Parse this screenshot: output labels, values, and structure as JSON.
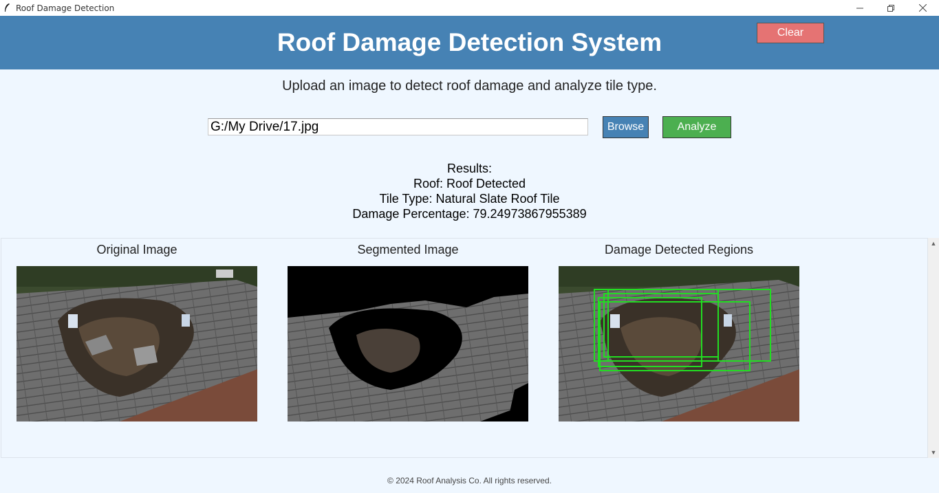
{
  "window": {
    "title": "Roof Damage Detection",
    "icon": "feather-icon"
  },
  "header": {
    "title": "Roof Damage Detection System",
    "clear_label": "Clear"
  },
  "subtitle": "Upload an image to detect roof damage and analyze tile type.",
  "file": {
    "path": "G:/My Drive/17.jpg",
    "browse_label": "Browse",
    "analyze_label": "Analyze"
  },
  "results": {
    "heading": "Results:",
    "roof": "Roof: Roof Detected",
    "tile_type": "Tile Type: Natural Slate Roof Tile",
    "damage": "Damage Percentage: 79.24973867955389"
  },
  "images": {
    "original_label": "Original Image",
    "segmented_label": "Segmented Image",
    "damage_label": "Damage Detected Regions"
  },
  "footer": "© 2024 Roof Analysis Co. All rights reserved.",
  "colors": {
    "header": "#4682b4",
    "clear": "#e57373",
    "browse": "#4682b4",
    "analyze": "#4caf50",
    "detection_box": "#22dd22"
  }
}
